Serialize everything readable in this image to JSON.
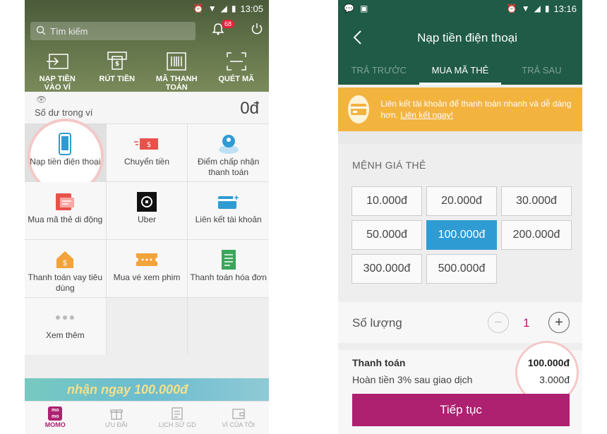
{
  "left": {
    "status_time": "13:05",
    "search_placeholder": "Tìm kiếm",
    "notification_count": "68",
    "quick_actions": [
      {
        "label": "NẠP TIỀN VÀO VÍ",
        "icon": "wallet-in-icon"
      },
      {
        "label": "RÚT TIỀN",
        "icon": "atm-withdraw-icon"
      },
      {
        "label": "MÃ THANH TOÁN",
        "icon": "barcode-icon"
      },
      {
        "label": "QUÉT MÃ",
        "icon": "scan-icon"
      }
    ],
    "balance_label": "Số dư trong ví",
    "balance_value": "0đ",
    "services": [
      {
        "label": "Nạp tiền điện thoại",
        "icon": "phone-icon",
        "color": "#2f9bd3"
      },
      {
        "label": "Chuyển tiền",
        "icon": "money-transfer-icon",
        "color": "#e8524a"
      },
      {
        "label": "Điểm chấp nhận thanh toán",
        "icon": "location-icon",
        "color": "#2f9bd3"
      },
      {
        "label": "Mua mã thẻ di động",
        "icon": "card-code-icon",
        "color": "#e8524a"
      },
      {
        "label": "Uber",
        "icon": "uber-icon",
        "color": "#111111"
      },
      {
        "label": "Liên kết tài khoản",
        "icon": "bank-card-icon",
        "color": "#2f9bd3"
      },
      {
        "label": "Thanh toán vay tiêu dùng",
        "icon": "loan-house-icon",
        "color": "#f3a33b"
      },
      {
        "label": "Mua vé xem phim",
        "icon": "ticket-icon",
        "color": "#f3a33b"
      },
      {
        "label": "Thanh toán hóa đơn",
        "icon": "bill-icon",
        "color": "#3aa65a"
      },
      {
        "label": "Xem thêm",
        "icon": "more-dots-icon",
        "color": "#bbbbbb"
      }
    ],
    "banner_text": "nhận ngay 100.000đ",
    "nav": [
      {
        "label": "MOMO",
        "icon": "momo-logo-icon"
      },
      {
        "label": "ƯU ĐÃI",
        "icon": "gift-icon"
      },
      {
        "label": "LỊCH SỬ GD",
        "icon": "history-icon"
      },
      {
        "label": "VÍ CỦA TÔI",
        "icon": "my-wallet-icon"
      }
    ]
  },
  "right": {
    "status_time": "13:16",
    "title": "Nạp tiền điện thoại",
    "tabs": [
      "TRẢ TRƯỚC",
      "MUA MÃ THẺ",
      "TRẢ SAU"
    ],
    "active_tab": 1,
    "notice_text": "Liên kết tài khoản để thanh toán nhanh và dễ dàng hơn.",
    "notice_link": "Liên kết ngay!",
    "section_title": "MỆNH GIÁ THẺ",
    "denominations": [
      "10.000đ",
      "20.000đ",
      "30.000đ",
      "50.000đ",
      "100.000đ",
      "200.000đ",
      "300.000đ",
      "500.000đ"
    ],
    "selected_denomination": 4,
    "quantity_label": "Số lượng",
    "quantity_value": "1",
    "payment_label": "Thanh toán",
    "payment_value": "100.000đ",
    "cashback_label": "Hoàn tiền 3% sau giao dịch",
    "cashback_value": "3.000đ",
    "continue_label": "Tiếp tục"
  },
  "colors": {
    "brand": "#ae2070",
    "header_green": "#1f5b46",
    "selected_blue": "#2f9bd3",
    "notice_orange": "#f3b33f"
  }
}
